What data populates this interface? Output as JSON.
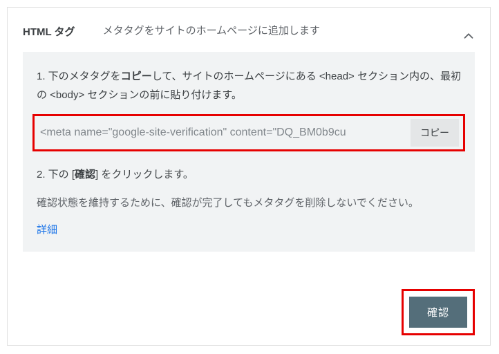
{
  "header": {
    "title": "HTML タグ",
    "description": "メタタグをサイトのホームページに追加します"
  },
  "step1": {
    "pre": "1. 下のメタタグを",
    "bold": "コピー",
    "post": "して、サイトのホームページにある <head> セクション内の、最初の <body> セクションの前に貼り付けます。"
  },
  "meta_code": "<meta name=\"google-site-verification\" content=\"DQ_BM0b9cu",
  "copy_label": "コピー",
  "step2": {
    "pre": "2. 下の [",
    "bold": "確認",
    "post": "] をクリックします。"
  },
  "note": "確認状態を維持するために、確認が完了してもメタタグを削除しないでください。",
  "details_label": "詳細",
  "confirm_label": "確認"
}
